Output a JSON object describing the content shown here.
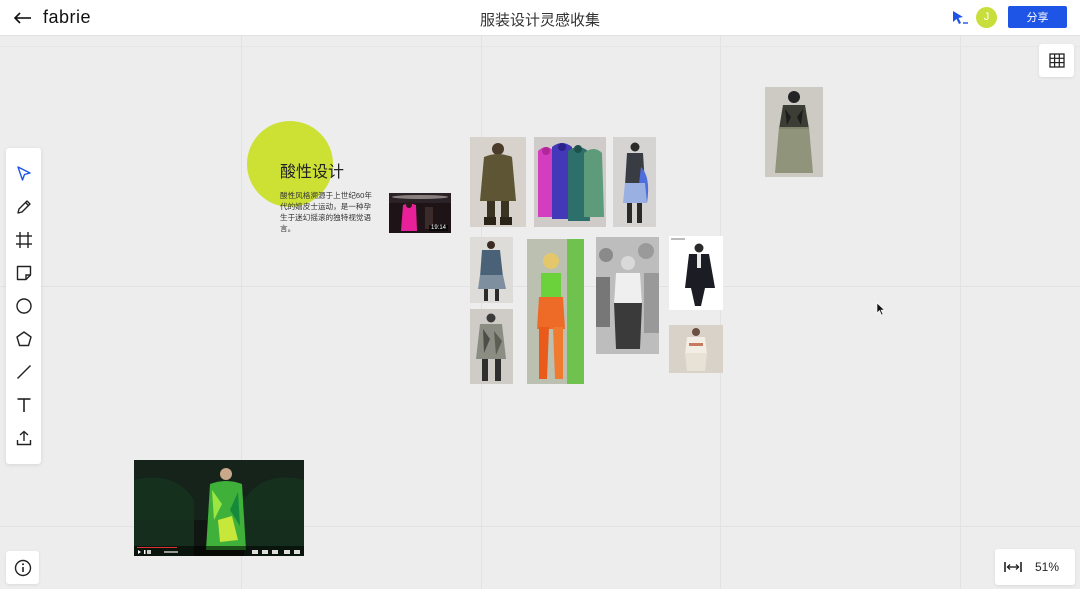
{
  "header": {
    "logo_text": "fabrie",
    "title": "服装设计灵感收集",
    "avatar_initial": "J",
    "share_label": "分享"
  },
  "toolbar": {
    "tools": [
      {
        "name": "select-tool",
        "icon": "cursor-arrow-icon"
      },
      {
        "name": "pen-tool",
        "icon": "pencil-icon"
      },
      {
        "name": "frame-tool",
        "icon": "frame-icon"
      },
      {
        "name": "sticky-note-tool",
        "icon": "sticky-note-icon"
      },
      {
        "name": "circle-tool",
        "icon": "circle-icon"
      },
      {
        "name": "polygon-tool",
        "icon": "pentagon-icon"
      },
      {
        "name": "line-tool",
        "icon": "line-icon"
      },
      {
        "name": "text-tool",
        "icon": "text-icon"
      },
      {
        "name": "upload-tool",
        "icon": "upload-icon"
      }
    ],
    "active_color": "#1f55e6"
  },
  "note": {
    "title": "酸性设计",
    "body": "酸性风格溯源于上世纪60年代的嬉皮士运动，是一种孕生于迷幻摇滚的独特视觉语言。",
    "accent_color": "#cde034"
  },
  "video_small": {
    "duration": "19:14"
  },
  "zoom": {
    "level": "51%"
  },
  "colors": {
    "brand_blue": "#1f55e6",
    "canvas_bg": "#ededed",
    "lime": "#cde034"
  }
}
